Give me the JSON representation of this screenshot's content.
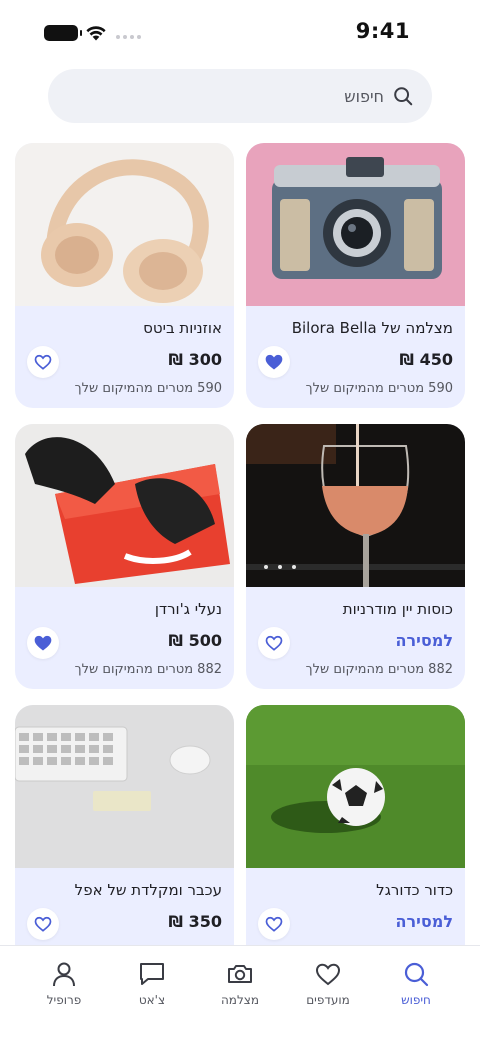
{
  "status_bar": {
    "time": "9:41"
  },
  "search": {
    "placeholder": "חיפוש",
    "value": ""
  },
  "products": [
    {
      "title": "מצלמה של Bilora Bella",
      "price": "450 ₪",
      "distance": "590 מטרים מהמיקום שלך",
      "favorited": true
    },
    {
      "title": "אוזניות ביטס",
      "price": "300 ₪",
      "distance": "590 מטרים מהמיקום שלך",
      "favorited": false
    },
    {
      "title": "כוסות יין מודרניות",
      "price": "למסירה",
      "distance": "882 מטרים מהמיקום שלך",
      "favorited": false
    },
    {
      "title": "נעלי ג'ורדן",
      "price": "500 ₪",
      "distance": "882 מטרים מהמיקום שלך",
      "favorited": true
    },
    {
      "title": "כדור כדורגל",
      "price": "למסירה",
      "distance": "",
      "favorited": false
    },
    {
      "title": "עכבר ומקלדת של אפל",
      "price": "350 ₪",
      "distance": "",
      "favorited": false
    }
  ],
  "tab_bar": {
    "items": [
      {
        "label": "חיפוש",
        "icon": "search-icon",
        "active": true
      },
      {
        "label": "מועדפים",
        "icon": "heart-icon",
        "active": false
      },
      {
        "label": "מצלמה",
        "icon": "camera-icon",
        "active": false
      },
      {
        "label": "צ'אט",
        "icon": "chat-icon",
        "active": false
      },
      {
        "label": "פרופיל",
        "icon": "user-icon",
        "active": false
      }
    ]
  },
  "colors": {
    "accent": "#4a5ed6",
    "card_background": "#ebeeff",
    "search_background": "#eff1f6"
  }
}
